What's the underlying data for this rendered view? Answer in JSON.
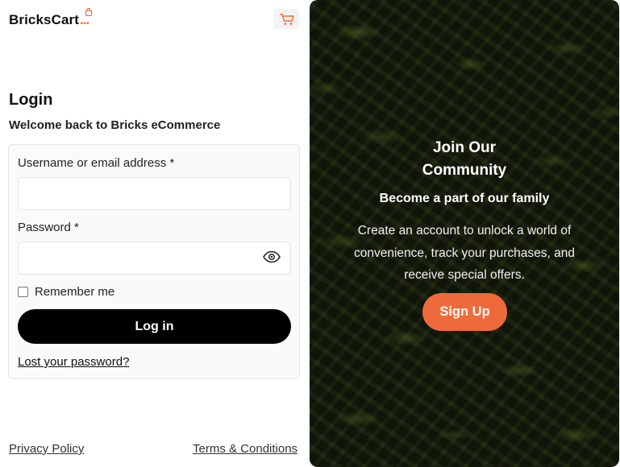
{
  "header": {
    "logo_text": "BricksCart",
    "logo_suffix": "...",
    "cart_icon": "shopping-cart-icon"
  },
  "login": {
    "title": "Login",
    "subtitle": "Welcome back to Bricks eCommerce",
    "username_label": "Username or email address *",
    "username_value": "",
    "password_label": "Password *",
    "password_value": "",
    "show_password_icon": "eye-icon",
    "remember_label": "Remember me",
    "remember_checked": false,
    "submit_label": "Log in",
    "lost_password_link": "Lost your password?"
  },
  "footer": {
    "privacy": "Privacy Policy",
    "terms": "Terms & Conditions"
  },
  "promo": {
    "title_line1": "Join Our",
    "title_line2": "Community",
    "tagline": "Become a part of our family",
    "description": "Create an account to unlock a world of convenience, track your purchases, and receive special offers.",
    "signup_label": "Sign Up"
  },
  "colors": {
    "accent": "#ef6a3a",
    "primary_button": "#000000",
    "panel_background": "#1e2614"
  }
}
